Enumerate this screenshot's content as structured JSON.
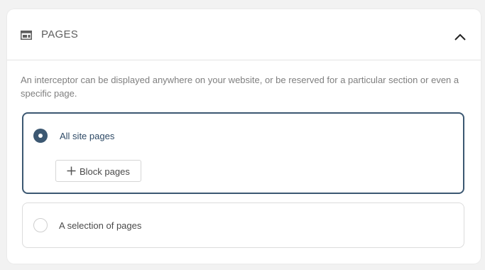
{
  "panel": {
    "title": "PAGES",
    "header_icon": "window-layout-icon",
    "collapse_icon": "chevron-up-icon",
    "description": "An interceptor can be displayed anywhere on your website, or be reserved for a particular section or even a specific page."
  },
  "options": [
    {
      "label": "All site pages",
      "selected": true,
      "button": {
        "icon": "plus-icon",
        "label": "Block pages"
      }
    },
    {
      "label": "A selection of pages",
      "selected": false
    }
  ],
  "colors": {
    "accent": "#3c5872",
    "text_muted": "#7f7f7f",
    "border": "#dcdcdc",
    "background": "#f2f2f2"
  }
}
